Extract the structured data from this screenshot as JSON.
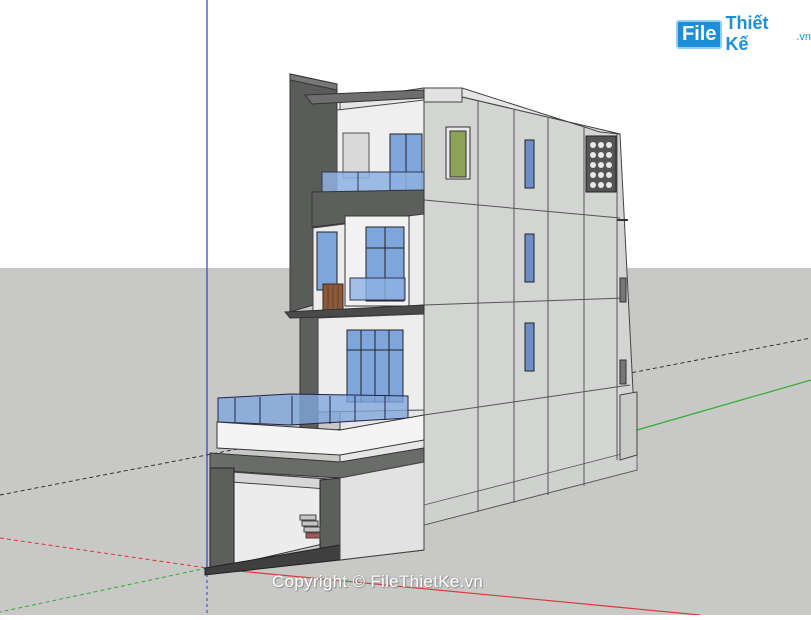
{
  "logo": {
    "file_text": "File",
    "brand_text": "Thiết Kế",
    "tld_text": ".vn"
  },
  "watermark": {
    "text": "Copyright © FileThietKe.vn"
  },
  "colors": {
    "sky": "#ffffff",
    "ground": "#c8c8c6",
    "wall": "#d4d6d4",
    "wall_dark": "#5b5d5b",
    "glass": "#7fa6dc",
    "wood": "#8a5a3c",
    "axis_blue": "#2e3bd6",
    "axis_red": "#d83a3a",
    "axis_green": "#2fae2f",
    "brand": "#1d8fd8"
  }
}
